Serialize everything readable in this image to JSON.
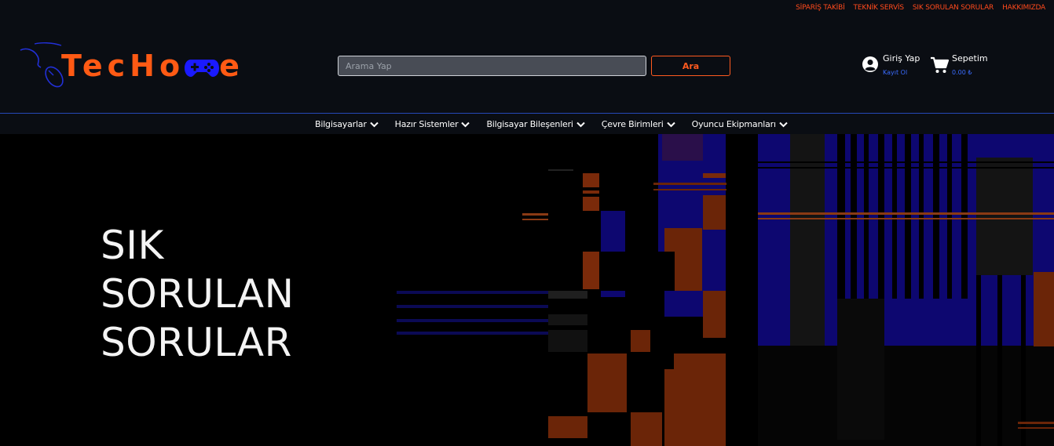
{
  "top_links": [
    "SİPARİŞ TAKİBİ",
    "TEKNİK SERVİS",
    "SIK SORULAN SORULAR",
    "HAKKIMIZDA"
  ],
  "logo": {
    "text_before": "TecHo",
    "text_after": "e",
    "icon": "gamepad-icon",
    "decoration": "mouse-icon"
  },
  "search": {
    "placeholder": "Arama Yap",
    "button_label": "Ara"
  },
  "account": {
    "title": "Giriş Yap",
    "subtitle": "Kayıt Ol",
    "icon": "user-circle-icon"
  },
  "cart": {
    "title": "Sepetim",
    "total": "0.00 ₺",
    "icon": "cart-icon"
  },
  "nav": {
    "items": [
      {
        "label": "Bilgisayarlar"
      },
      {
        "label": "Hazır Sistemler"
      },
      {
        "label": "Bilgisayar Bileşenleri"
      },
      {
        "label": "Çevre Birimleri"
      },
      {
        "label": "Oyuncu Ekipmanları"
      }
    ]
  },
  "hero": {
    "lines": [
      "SIK",
      "SORULAN",
      "SORULAR"
    ]
  },
  "colors": {
    "accent": "#ff5a14",
    "link_blue": "#3a6cff",
    "header_bg": "#0a0d13",
    "nav_border": "#2649b8",
    "gamepad": "#1a1aff"
  }
}
